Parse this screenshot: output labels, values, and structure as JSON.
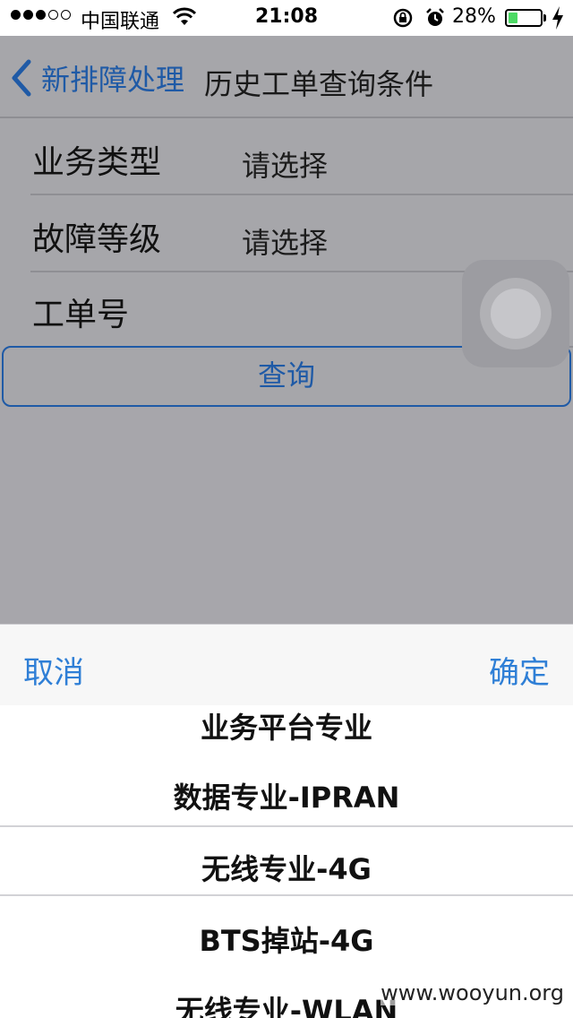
{
  "status_bar": {
    "carrier": "中国联通",
    "time": "21:08",
    "battery_percent": "28%",
    "battery_level": 0.28
  },
  "nav": {
    "back_label": "新排障处理",
    "title": "历史工单查询条件"
  },
  "form": {
    "rows": [
      {
        "label": "业务类型",
        "value": "请选择"
      },
      {
        "label": "故障等级",
        "value": "请选择"
      },
      {
        "label": "工单号",
        "value": ""
      }
    ],
    "query_button": "查询"
  },
  "picker": {
    "cancel": "取消",
    "confirm": "确定",
    "items": [
      "业务平台专业",
      "数据专业-IPRAN",
      "无线专业-4G",
      "BTS掉站-4G",
      "无线专业-WLAN"
    ],
    "selected_index": 2
  },
  "watermark": "www.wooyun.org",
  "icons": {
    "back": "chevron-left-icon",
    "wifi": "wifi-icon",
    "lock": "rotation-lock-icon",
    "alarm": "alarm-icon",
    "charging": "bolt-icon"
  },
  "colors": {
    "accent": "#2f7fd6",
    "nav_accent": "#1f5aa6",
    "battery": "#4cd964"
  }
}
